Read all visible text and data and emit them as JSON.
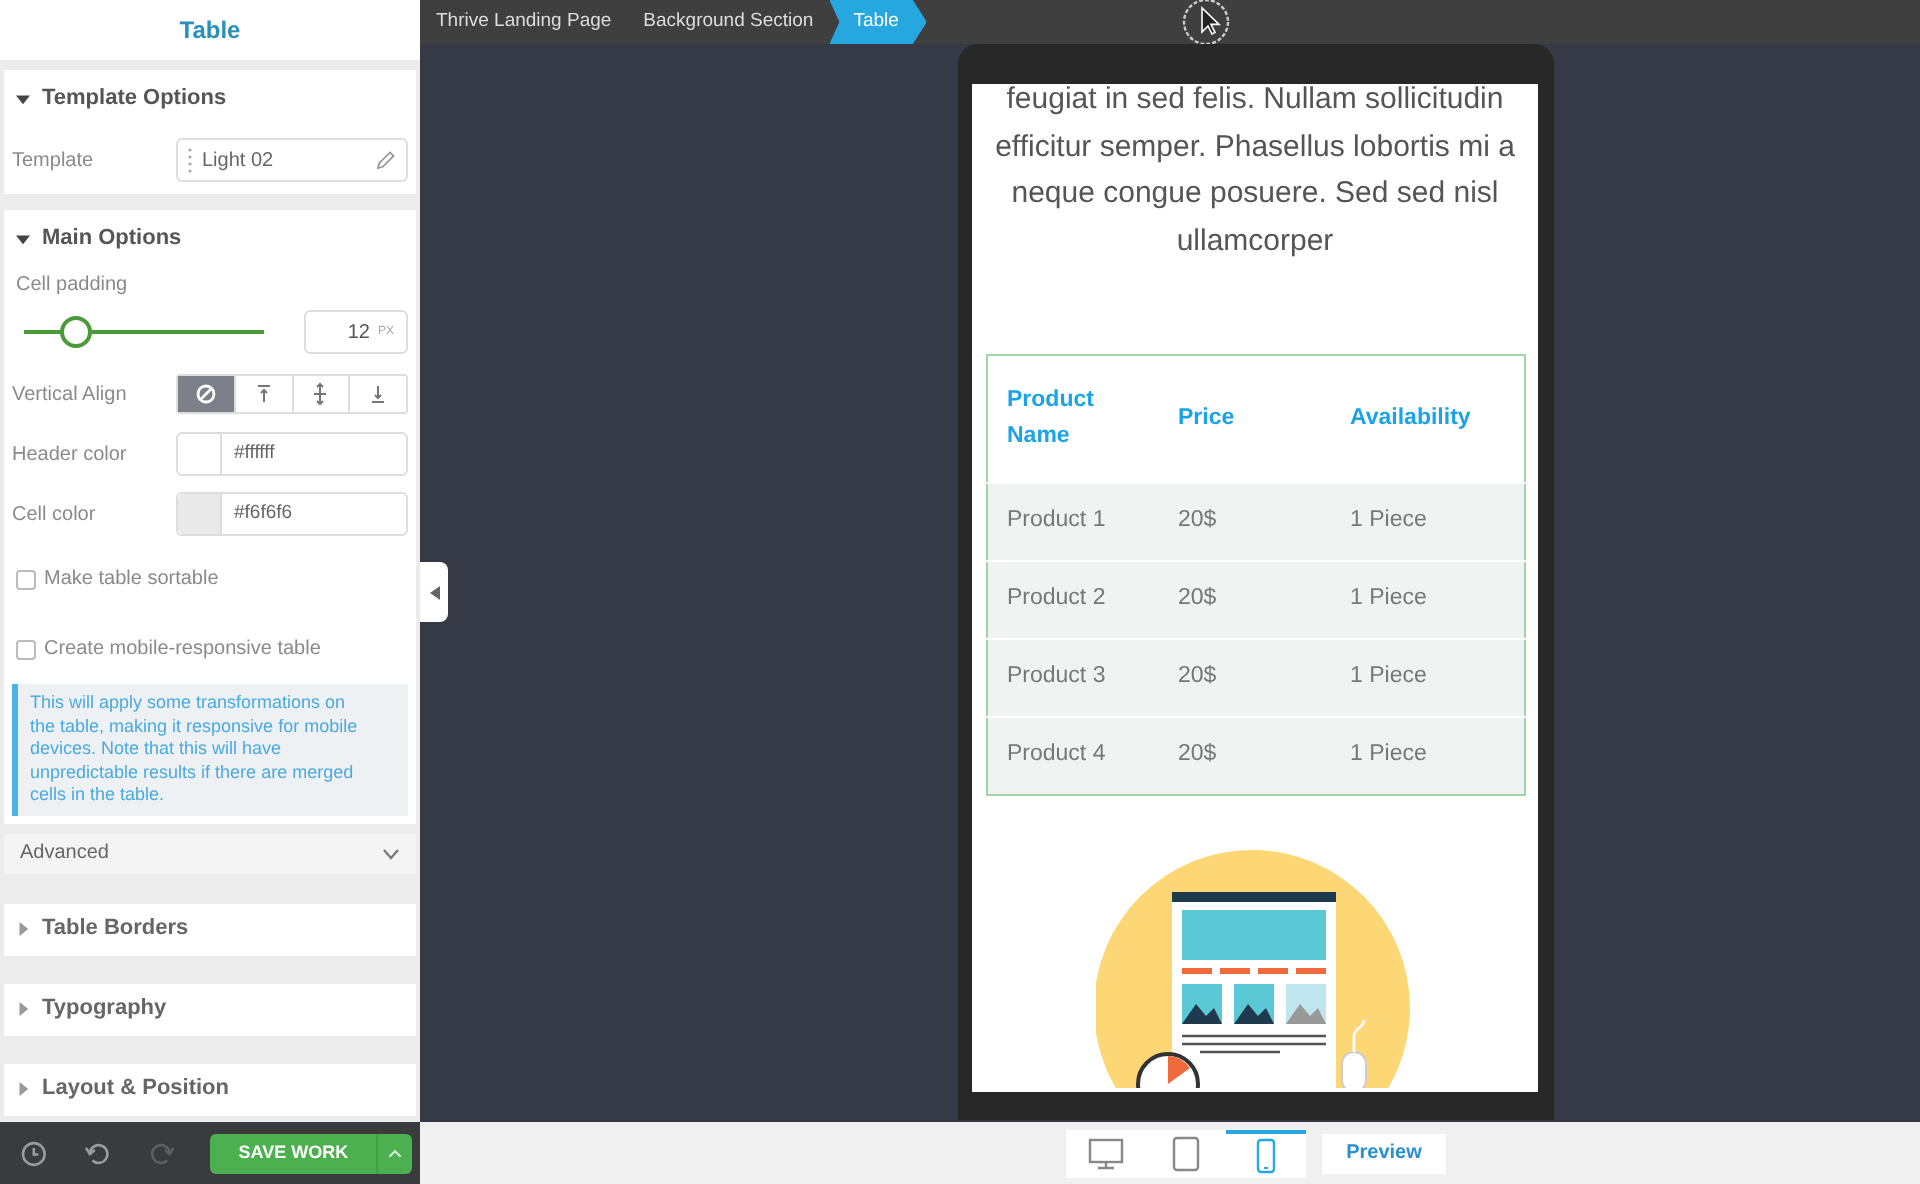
{
  "panel": {
    "title": "Table",
    "template_options": {
      "title": "Template Options",
      "expanded": true,
      "label": "Template",
      "value": "Light 02"
    },
    "main_options": {
      "title": "Main Options",
      "expanded": true,
      "cell_padding": {
        "label": "Cell padding",
        "level": 0.22,
        "value": "12",
        "unit": "PX"
      },
      "vertical_align": {
        "label": "Vertical Align",
        "options": [
          {
            "kind": "none",
            "selected": true
          },
          {
            "kind": "top",
            "selected": false
          },
          {
            "kind": "middle",
            "selected": false
          },
          {
            "kind": "bottom",
            "selected": false
          }
        ]
      },
      "colors": [
        {
          "label": "Header color",
          "value": "#ffffff",
          "color": "#ffffff"
        },
        {
          "label": "Cell color",
          "value": "#f6f6f6",
          "color": "#e9e9e9"
        }
      ],
      "checkboxes": [
        {
          "label": "Make table sortable",
          "checked": false
        },
        {
          "label": "Create mobile-responsive table",
          "checked": false
        }
      ],
      "note": "This will apply some transformations on the table, making it responsive for mobile devices. Note that this will have unpredictable results if there are merged cells in the table.",
      "advanced": {
        "label": "Advanced",
        "expanded": false
      }
    },
    "sections": [
      {
        "title": "Table Borders",
        "expanded": false
      },
      {
        "title": "Typography",
        "expanded": false
      },
      {
        "title": "Layout & Position",
        "expanded": false
      }
    ],
    "footer": {
      "tools": [
        {
          "kind": "history",
          "disabled": false
        },
        {
          "kind": "undo",
          "disabled": false
        },
        {
          "kind": "redo",
          "disabled": true
        }
      ],
      "save": "SAVE WORK"
    }
  },
  "breadcrumbs": [
    {
      "label": "Thrive Landing Page",
      "selected": false
    },
    {
      "label": "Background Section",
      "selected": false
    },
    {
      "label": "Table",
      "selected": true
    }
  ],
  "preview": {
    "paragraph": "feugiat in sed felis. Nullam sollicitudin efficitur semper. Phasellus lobortis mi a neque congue posuere. Sed sed nisl ullamcorper",
    "table": {
      "columns": [
        "Product Name",
        "Price",
        "Availability"
      ],
      "rows": [
        [
          "Product 1",
          "20$",
          "1 Piece"
        ],
        [
          "Product 2",
          "20$",
          "1 Piece"
        ],
        [
          "Product 3",
          "20$",
          "1 Piece"
        ],
        [
          "Product 4",
          "20$",
          "1 Piece"
        ]
      ]
    }
  },
  "devices": [
    {
      "kind": "desktop",
      "selected": false
    },
    {
      "kind": "tablet",
      "selected": false
    },
    {
      "kind": "mobile",
      "selected": true
    }
  ],
  "preview_button": "Preview"
}
